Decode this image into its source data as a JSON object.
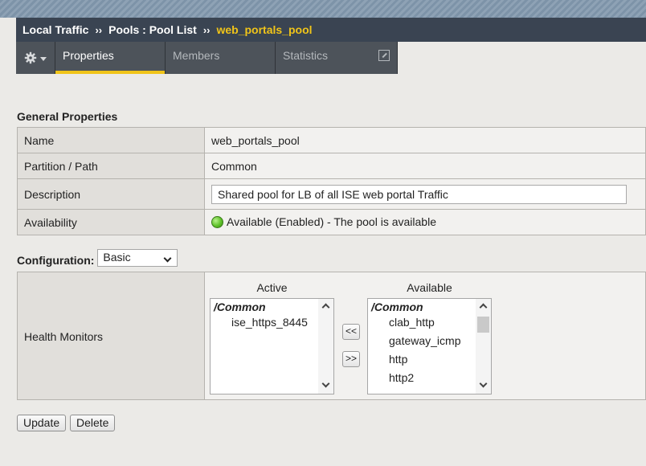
{
  "breadcrumb": {
    "part1": "Local Traffic",
    "sep1": "››",
    "part2": "Pools : Pool List",
    "sep2": "››",
    "current": "web_portals_pool"
  },
  "tabs": {
    "properties": "Properties",
    "members": "Members",
    "statistics": "Statistics"
  },
  "general": {
    "title": "General Properties",
    "rows": [
      {
        "label": "Name",
        "value": "web_portals_pool"
      },
      {
        "label": "Partition / Path",
        "value": "Common"
      },
      {
        "label": "Description",
        "value": "Shared pool for LB of all ISE web portal Traffic"
      },
      {
        "label": "Availability",
        "value": "Available (Enabled) - The pool is available"
      }
    ]
  },
  "configuration": {
    "label": "Configuration:",
    "selected": "Basic"
  },
  "health_monitors": {
    "label": "Health Monitors",
    "active_heading": "Active",
    "available_heading": "Available",
    "active_group": "/Common",
    "active_items": [
      "ise_https_8445"
    ],
    "available_group": "/Common",
    "available_items": [
      "clab_http",
      "gateway_icmp",
      "http",
      "http2"
    ],
    "move_left": "<<",
    "move_right": ">>"
  },
  "buttons": {
    "update": "Update",
    "delete": "Delete"
  },
  "colors": {
    "accent": "#f0c419",
    "title_bar": "#3a4452",
    "tab_bg": "#4d535a",
    "status_green": "#5fc12a"
  }
}
